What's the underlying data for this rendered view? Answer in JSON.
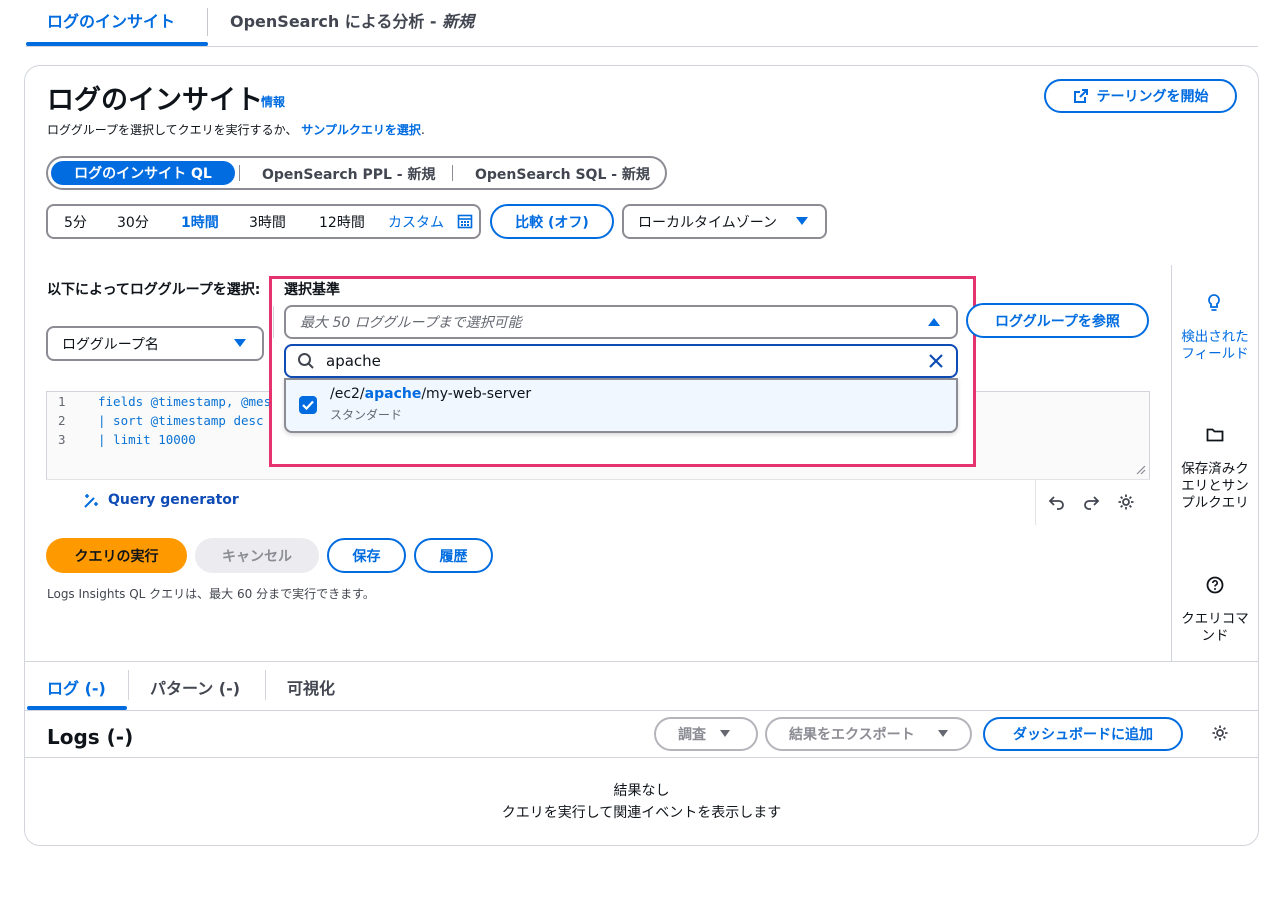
{
  "top_tabs": {
    "insights": "ログのインサイト",
    "opensearch_prefix": "OpenSearch による分析 - ",
    "opensearch_new": "新規"
  },
  "header": {
    "title": "ログのインサイト",
    "info": "情報",
    "desc_prefix": "ロググループを選択してクエリを実行するか、",
    "desc_link": "サンプルクエリを選択",
    "desc_suffix": ".",
    "tail_button": "テーリングを開始"
  },
  "query_language": {
    "items": [
      "ログのインサイト QL",
      "OpenSearch PPL - 新規",
      "OpenSearch SQL - 新規"
    ],
    "selected": "ログのインサイト QL"
  },
  "time_range": {
    "items": [
      "5分",
      "30分",
      "1時間",
      "3時間",
      "12時間"
    ],
    "selected": "1時間",
    "custom": "カスタム",
    "compare_button": "比較 (オフ)",
    "timezone": "ローカルタイムゾーン"
  },
  "log_group_selector": {
    "by_label": "以下によってロググループを選択:",
    "by_value": "ロググループ名",
    "criteria_label": "選択基準",
    "criteria_placeholder": "最大 50 ロググループまで選択可能",
    "browse_button": "ロググループを参照",
    "search_value": "apache",
    "results": [
      {
        "path_prefix": "/ec2/",
        "path_match": "apache",
        "path_suffix": "/my-web-server",
        "subtitle": "スタンダード",
        "checked": true
      }
    ]
  },
  "editor": {
    "lines": [
      {
        "num": "1",
        "text": "fields @timestamp, @mess"
      },
      {
        "num": "2",
        "text": "| sort @timestamp desc"
      },
      {
        "num": "3",
        "text": "| limit 10000"
      }
    ],
    "generator": "Query generator"
  },
  "actions": {
    "run": "クエリの実行",
    "cancel": "キャンセル",
    "save": "保存",
    "history": "履歴",
    "note": "Logs Insights QL クエリは、最大 60 分まで実行できます。"
  },
  "side_panel": {
    "discovered": "検出されたフィールド",
    "saved": "保存済みクエリとサンプルクエリ",
    "commands": "クエリコマンド"
  },
  "results": {
    "tabs": [
      "ログ (-)",
      "パターン (-)",
      "可視化"
    ],
    "selected_tab": "ログ (-)",
    "title": "Logs (-)",
    "investigate": "調査",
    "export": "結果をエクスポート",
    "add_dashboard": "ダッシュボードに追加",
    "empty_title": "結果なし",
    "empty_desc": "クエリを実行して関連イベントを表示します"
  },
  "colors": {
    "accent": "#006ce0",
    "primary_button": "#ff9900",
    "highlight_border": "#e6336f"
  }
}
